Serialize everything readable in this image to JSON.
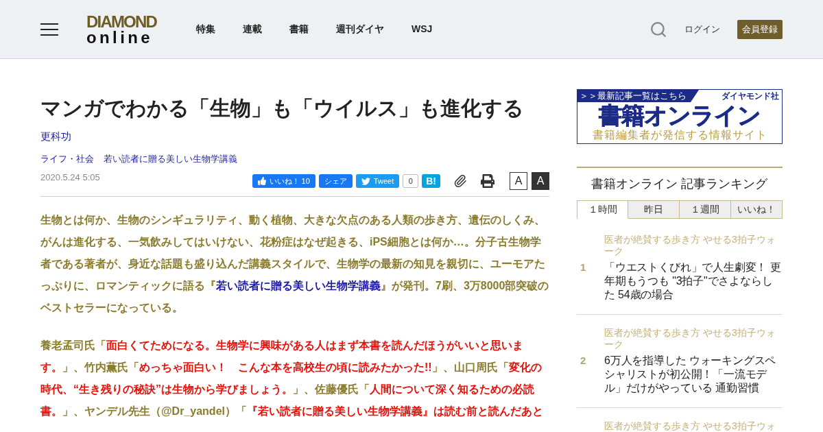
{
  "header": {
    "logo": {
      "top": "DIAMOND",
      "bottom": "online"
    },
    "nav": [
      "特集",
      "連載",
      "書籍",
      "週刊ダイヤ",
      "WSJ"
    ],
    "login": "ログイン",
    "register": "会員登録"
  },
  "article": {
    "title": "マンガでわかる「生物」も「ウイルス」も進化する",
    "author": "更科功",
    "categories": [
      "ライフ・社会",
      "若い読者に贈る美しい生物学講義"
    ],
    "date": "2020.5.24 5:05",
    "share": [
      {
        "kind": "like",
        "label": "いいね！ 10"
      },
      {
        "kind": "share",
        "label": "シェア"
      },
      {
        "kind": "tweet",
        "label": "Tweet",
        "count": "0"
      },
      {
        "kind": "hatena",
        "label": "B!"
      }
    ],
    "font_sizes": [
      {
        "label": "A",
        "selected": false
      },
      {
        "label": "A",
        "selected": true
      }
    ],
    "paragraphs": [
      {
        "segments": [
          {
            "kind": "plain",
            "text": "生物とは何か、生物のシンギュラリティ、動く植物、大きな欠点のある人類の歩き方、遺伝のしくみ、がんは進化する、一気飲みしてはいけない、花粉症はなぜ起きる、iPS細胞とは何か…。分子古生物学者である著者が、身近な話題も盛り込んだ講義スタイルで、生物学の最新の知見を親切に、ユーモアたっぷりに、ロマンティックに語る『"
          },
          {
            "kind": "link",
            "text": "若い読者に贈る美しい生物学講義"
          },
          {
            "kind": "plain",
            "text": "』が発刊。7刷、3万8000部突破のベストセラーになっている。"
          }
        ]
      },
      {
        "segments": [
          {
            "kind": "plain",
            "text": "養老孟司氏「"
          },
          {
            "kind": "quote",
            "text": "面白くてためになる。生物学に興味がある人はまず本書を読んだほうがいいと思います。"
          },
          {
            "kind": "plain",
            "text": "」、竹内薫氏「"
          },
          {
            "kind": "quote",
            "text": "めっちゃ面白い！　こんな本を高校生の頃に読みたかった!!"
          },
          {
            "kind": "plain",
            "text": "」、山口周氏「"
          },
          {
            "kind": "quote",
            "text": "変化の時代、“生き残りの秘訣”は生物から学びましょう。"
          },
          {
            "kind": "plain",
            "text": "」、佐藤優氏「"
          },
          {
            "kind": "quote",
            "text": "人間について深く知るための必読書。"
          },
          {
            "kind": "plain",
            "text": "」、ヤンデル先生（@Dr_yandel）「"
          },
          {
            "kind": "quote",
            "text": "『若い読者に贈る美しい生物学講義』は読む前と読んだあと"
          }
        ]
      }
    ]
  },
  "sidebar": {
    "banner": {
      "tag": "＞＞最新記事一覧はこちら",
      "publisher": "ダイヤモンド社",
      "name": "書籍オンライン",
      "tagline": "書籍編集者が発信する情報サイト"
    },
    "ranking": {
      "title": "書籍オンライン 記事ランキング",
      "tabs": [
        {
          "label": "１時間",
          "selected": true
        },
        {
          "label": "昨日",
          "selected": false
        },
        {
          "label": "１週間",
          "selected": false
        },
        {
          "label": "いいね！",
          "selected": false
        }
      ],
      "items": [
        {
          "category": "医者が絶賛する歩き方 やせる3拍子ウォーク",
          "rank": "1",
          "title": "「ウエストくびれ」で人生劇変！ 更年期もうつも \"3拍子\"でさよならした 54歳の場合"
        },
        {
          "category": "医者が絶賛する歩き方 やせる3拍子ウォーク",
          "rank": "2",
          "title": "6万人を指導した ウォーキングスペシャリストが初公開！「一流モデル」だけがやっている 通勤習慣"
        },
        {
          "category": "医者が絶賛する歩き方 やせる3拍子ウォ"
        }
      ]
    }
  }
}
